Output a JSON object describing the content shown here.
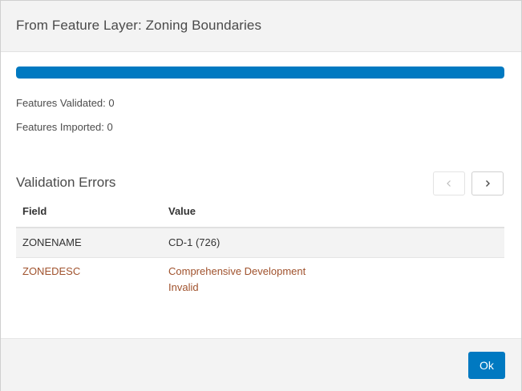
{
  "dialog": {
    "title": "From Feature Layer: Zoning Boundaries"
  },
  "progress": {
    "percent": 100,
    "color": "#0079c1"
  },
  "stats": {
    "validated_label": "Features Validated: 0",
    "imported_label": "Features Imported: 0"
  },
  "validation": {
    "title": "Validation Errors",
    "prev_icon": "chevron-left-icon",
    "next_icon": "chevron-right-icon",
    "columns": {
      "field": "Field",
      "value": "Value"
    },
    "rows": [
      {
        "field": "ZONENAME",
        "value_line1": "CD-1 (726)"
      },
      {
        "field": "ZONEDESC",
        "value_line1": "Comprehensive Development",
        "value_line2": "Invalid"
      }
    ],
    "error_color": "#a0522d"
  },
  "footer": {
    "ok_label": "Ok",
    "accent": "#0079c1"
  }
}
